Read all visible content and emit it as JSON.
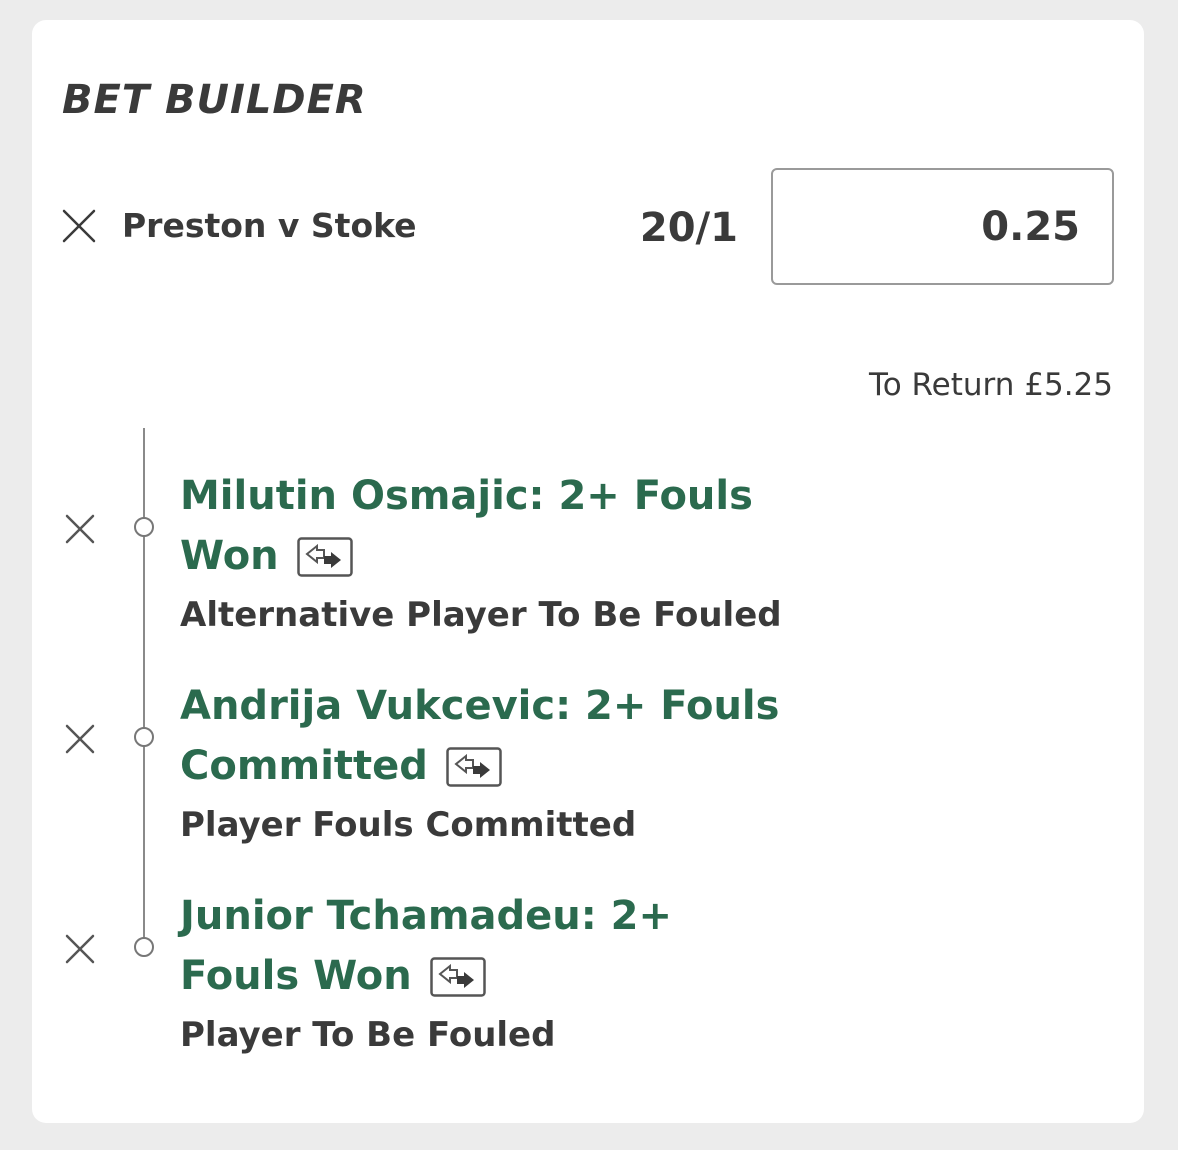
{
  "header": {
    "title": "BET BUILDER"
  },
  "bet": {
    "match": "Preston v Stoke",
    "odds": "20/1",
    "stake": "0.25",
    "to_return": "To Return £5.25"
  },
  "selections": [
    {
      "title_line1": "Milutin Osmajic: 2+ Fouls",
      "title_line2": "Won",
      "market": "Alternative Player To Be Fouled"
    },
    {
      "title_line1": "Andrija Vukcevic: 2+ Fouls",
      "title_line2": "Committed",
      "market": "Player Fouls Committed"
    },
    {
      "title_line1": "Junior Tchamadeu: 2+",
      "title_line2": "Fouls Won",
      "market": "Player To Be Fouled"
    }
  ],
  "icons": {
    "remove": "close-icon",
    "swap": "swap-player-icon"
  },
  "colors": {
    "selection_green": "#2b6a4e",
    "text_dark": "#3a3a3a",
    "background": "#ececec",
    "card": "#ffffff"
  }
}
